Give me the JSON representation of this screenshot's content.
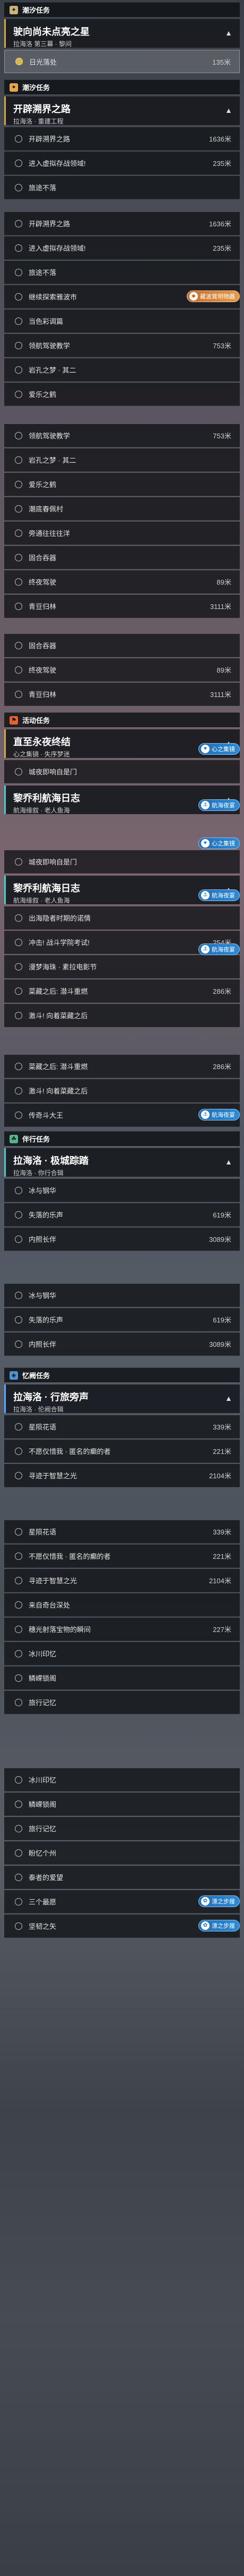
{
  "sections": {
    "tide": {
      "title": "潮汐任务",
      "color": "#c9b37a",
      "icon": "star-icon"
    },
    "tide2": {
      "title": "潮汐任务",
      "color": "#e7a84b",
      "icon": "star-icon"
    },
    "activity": {
      "title": "活动任务",
      "color": "#e4632e",
      "icon": "flag-icon"
    },
    "companion": {
      "title": "伴行任务",
      "color": "#55b58c",
      "icon": "companion-icon"
    },
    "memory": {
      "title": "忆阙任务",
      "color": "#4e93d6",
      "icon": "memory-icon"
    }
  },
  "quests": {
    "q1": {
      "title": "驶向尚未点亮之星",
      "sub": "拉海洛 第三幕 · 黎间"
    },
    "q2": {
      "title": "开辟溯界之路",
      "sub": "拉海洛 · 重建工程"
    },
    "q3": {
      "title": "直至永夜终结",
      "sub": "心之集镜 · 失序梦迷"
    },
    "q4": {
      "title": "黎乔利航海日志",
      "sub": "航海缘叙 · 老人鱼海"
    },
    "q5": {
      "title": "黎乔利航海日志",
      "sub": "航海缘叙 · 老人鱼海"
    },
    "q6": {
      "title": "拉海洛 · 极城踪踏",
      "sub": "拉海洛 · 你行合辑"
    },
    "q7": {
      "title": "拉海洛 · 行旅旁声",
      "sub": "拉海洛 · 伦阙合辑"
    }
  },
  "steps": {
    "s1": {
      "label": "日光落处",
      "dist": "135米"
    },
    "s2": {
      "label": "开辟溯界之路",
      "dist": "1636米"
    },
    "s3": {
      "label": "进入虚拟存战领域!",
      "dist": "235米"
    },
    "s4": {
      "label": "旅途不落",
      "dist": ""
    },
    "s5": {
      "label": "开辟溯界之路",
      "dist": "1636米"
    },
    "s6": {
      "label": "进入虚拟存战领域!",
      "dist": "235米"
    },
    "s7": {
      "label": "旅途不落",
      "dist": ""
    },
    "s8": {
      "label": "继续探索雅波市",
      "dist": ""
    },
    "s9": {
      "label": "当色彩调篇",
      "dist": ""
    },
    "s10": {
      "label": "领航驾驶教学",
      "dist": "753米"
    },
    "s11": {
      "label": "岩孔之梦 · 其二",
      "dist": ""
    },
    "s12": {
      "label": "爱乐之鹤",
      "dist": ""
    },
    "s13": {
      "label": "领航驾驶教学",
      "dist": "753米"
    },
    "s14": {
      "label": "岩孔之梦 · 其二",
      "dist": ""
    },
    "s15": {
      "label": "爱乐之鹤",
      "dist": ""
    },
    "s16": {
      "label": "潮底春佩村",
      "dist": ""
    },
    "s17": {
      "label": "旁通往往往洋",
      "dist": ""
    },
    "s18": {
      "label": "固合吞器",
      "dist": ""
    },
    "s19": {
      "label": "终夜驾驶",
      "dist": "89米"
    },
    "s20": {
      "label": "青豆归林",
      "dist": "3111米"
    },
    "s21": {
      "label": "固合吞器",
      "dist": ""
    },
    "s22": {
      "label": "终夜驾驶",
      "dist": "89米"
    },
    "s23": {
      "label": "青豆归林",
      "dist": "3111米"
    },
    "s24": {
      "label": "城夜即响自是门",
      "dist": ""
    },
    "s25": {
      "label": "城夜即响自是门",
      "dist": ""
    },
    "s26": {
      "label": "出海隐者时期的诺情",
      "dist": ""
    },
    "s27": {
      "label": "冲击! 战斗学院考试!",
      "dist": "254米"
    },
    "s28": {
      "label": "漫梦海珠 · 素拉电影节",
      "dist": ""
    },
    "s29": {
      "label": "菜藏之后: 潜斗重燃",
      "dist": "286米"
    },
    "s30": {
      "label": "激斗! 向着菜藏之后",
      "dist": ""
    },
    "s31": {
      "label": "菜藏之后: 潜斗重燃",
      "dist": "286米"
    },
    "s32": {
      "label": "激斗! 向着菜藏之后",
      "dist": ""
    },
    "s33": {
      "label": "传奇斗大王",
      "dist": ""
    },
    "s34": {
      "label": "冰与钢华",
      "dist": ""
    },
    "s35": {
      "label": "失落的乐声",
      "dist": "619米"
    },
    "s36": {
      "label": "内照长伴",
      "dist": "3089米"
    },
    "s37": {
      "label": "冰与钢华",
      "dist": ""
    },
    "s38": {
      "label": "失落的乐声",
      "dist": "619米"
    },
    "s39": {
      "label": "内照长伴",
      "dist": "3089米"
    },
    "s40": {
      "label": "星陨花语",
      "dist": "339米"
    },
    "s41": {
      "label": "不愿仅惜我 · 匿名的癫的者",
      "dist": "221米"
    },
    "s42": {
      "label": "寻迹于智慧之光",
      "dist": "2104米"
    },
    "s43": {
      "label": "星陨花语",
      "dist": "339米"
    },
    "s44": {
      "label": "不愿仅惜我 · 匿名的癫的者",
      "dist": "221米"
    },
    "s45": {
      "label": "寻迹于智慧之光",
      "dist": "2104米"
    },
    "s46": {
      "label": "来自奇台深处",
      "dist": ""
    },
    "s47": {
      "label": "穗光射落宝物的瞬间",
      "dist": "227米"
    },
    "s48": {
      "label": "冰川印忆",
      "dist": ""
    },
    "s49": {
      "label": "鳞嵘锁阁",
      "dist": ""
    },
    "s50": {
      "label": "旅行记忆",
      "dist": ""
    },
    "s51": {
      "label": "冰川印忆",
      "dist": ""
    },
    "s52": {
      "label": "鳞嵘锁阁",
      "dist": ""
    },
    "s53": {
      "label": "旅行记忆",
      "dist": ""
    },
    "s54": {
      "label": "盼忆个州",
      "dist": ""
    },
    "s55": {
      "label": "泰者的爱望",
      "dist": ""
    },
    "s56": {
      "label": "三个最愿",
      "dist": ""
    },
    "s57": {
      "label": "坚韧之矢",
      "dist": ""
    }
  },
  "tags": {
    "t1": {
      "label": "藏波茸明物器"
    },
    "t2": {
      "label": "心之集镜"
    },
    "t3": {
      "label": "航海夜宴"
    },
    "t4": {
      "label": "心之集镜"
    },
    "t5": {
      "label": "航海夜宴"
    },
    "t6": {
      "label": "航海夜宴"
    },
    "t7": {
      "label": "航海夜宴"
    },
    "t8": {
      "label": "漂之步履"
    },
    "t9": {
      "label": "漂之步履"
    }
  },
  "colors": {
    "accent_gold": "#d9b552",
    "accent_blue": "#2c8ad6",
    "accent_orange": "#e59a49"
  }
}
